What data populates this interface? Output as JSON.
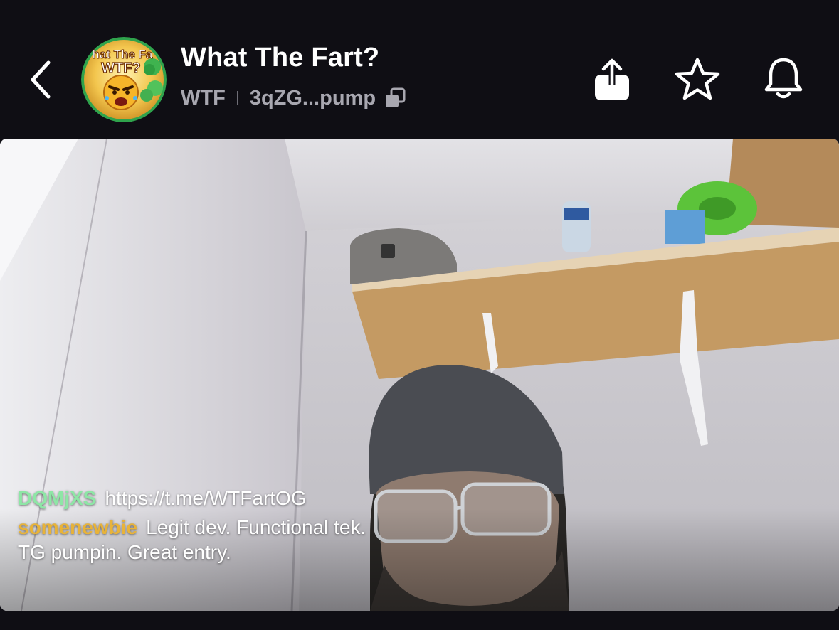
{
  "header": {
    "title": "What The Fart?",
    "ticker": "WTF",
    "address": "3qZG...pump",
    "avatar_text_top": "hat The Fa",
    "avatar_text_mid": "WTF?"
  },
  "icons": {
    "back": "chevron-left-icon",
    "copy": "copy-icon",
    "share": "share-icon",
    "favorite": "star-icon",
    "notifications": "bell-icon"
  },
  "chat": [
    {
      "user": "DQMjXS",
      "user_color": "#8ee6a6",
      "text": "https://t.me/WTFartOG"
    },
    {
      "user": "somenewbie",
      "user_color": "#e8b339",
      "text": "Legit dev. Functional tek. TG pumpin. Great entry."
    }
  ],
  "colors": {
    "background": "#0f0e14",
    "text_primary": "#ffffff",
    "text_secondary": "#a8a7b0"
  }
}
